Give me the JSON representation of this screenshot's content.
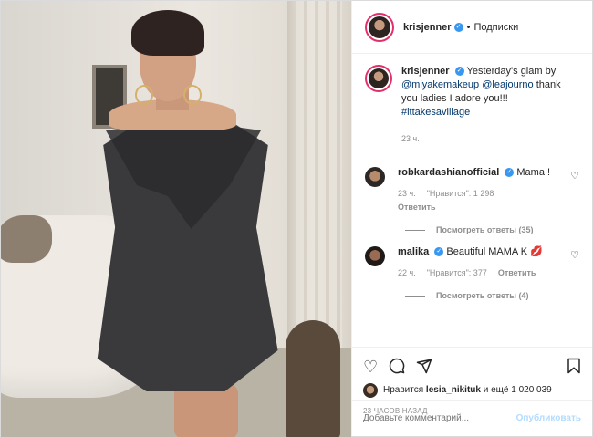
{
  "header": {
    "username": "krisjenner",
    "separator": "•",
    "follow_label": "Подписки"
  },
  "caption": {
    "username": "krisjenner",
    "text_1": "Yesterday's glam by",
    "mention_1": "@miyakemakeup",
    "mention_2": "@leajourno",
    "text_2": "thank you ladies I adore you!!!",
    "hashtag": "#ittakesavillage",
    "time": "23 ч."
  },
  "comments": [
    {
      "username": "robkardashianofficial",
      "text": "Mama !",
      "time": "23 ч.",
      "likes": "\"Нравится\": 1 298",
      "reply": "Ответить",
      "view_replies": "Посмотреть ответы (35)"
    },
    {
      "username": "malika",
      "text": "Beautiful MAMA K",
      "emoji": "💋",
      "time": "22 ч.",
      "likes": "\"Нравится\": 377",
      "reply": "Ответить",
      "view_replies": "Посмотреть ответы (4)"
    }
  ],
  "actions": {
    "liked_by_prefix": "Нравится",
    "liked_by_user": "lesia_nikituk",
    "liked_by_suffix": "и ещё 1 020 039",
    "timestamp": "23 ЧАСОВ НАЗАД"
  },
  "add_comment": {
    "placeholder": "Добавьте комментарий...",
    "publish_label": "Опубликовать"
  },
  "icons": {
    "like": "heart-icon",
    "comment": "comment-icon",
    "share": "share-icon",
    "save": "bookmark-icon"
  },
  "colors": {
    "verified": "#3897f0",
    "link": "#00376b",
    "muted": "#8e8e8e",
    "publish_disabled": "#b3dbff",
    "story_ring": "#e1306c"
  }
}
